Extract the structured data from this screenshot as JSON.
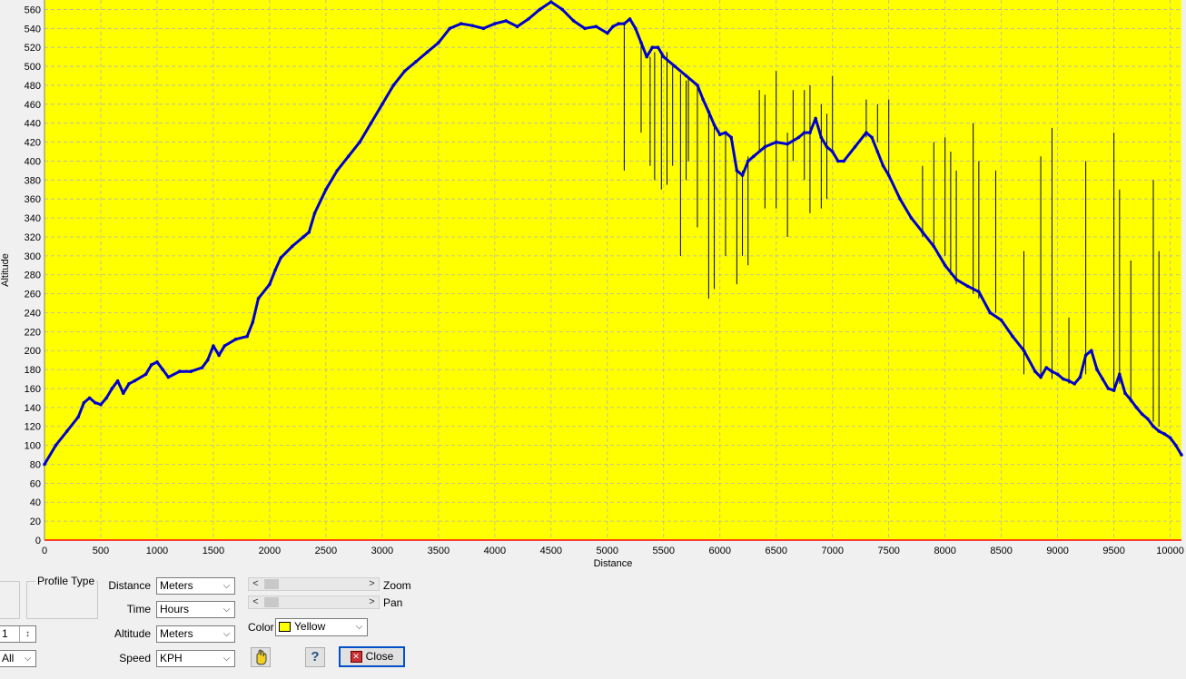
{
  "chart_data": {
    "type": "line",
    "xlabel": "Distance",
    "ylabel": "Altitude",
    "xlim": [
      0,
      10100
    ],
    "ylim": [
      0,
      570
    ],
    "x_ticks": [
      0,
      500,
      1000,
      1500,
      2000,
      2500,
      3000,
      3500,
      4000,
      4500,
      5000,
      5500,
      6000,
      6500,
      7000,
      7500,
      8000,
      8500,
      9000,
      9500,
      10000
    ],
    "y_ticks": [
      0,
      20,
      40,
      60,
      80,
      100,
      120,
      140,
      160,
      180,
      200,
      220,
      240,
      260,
      280,
      300,
      320,
      340,
      360,
      380,
      400,
      420,
      440,
      460,
      480,
      500,
      520,
      540,
      560
    ],
    "grid": true,
    "background_color": "#ffff00",
    "line_color": "#0000cc",
    "series": [
      {
        "values": [
          [
            0,
            80
          ],
          [
            100,
            100
          ],
          [
            200,
            115
          ],
          [
            300,
            130
          ],
          [
            350,
            145
          ],
          [
            400,
            150
          ],
          [
            450,
            145
          ],
          [
            500,
            143
          ],
          [
            550,
            150
          ],
          [
            600,
            160
          ],
          [
            650,
            168
          ],
          [
            700,
            155
          ],
          [
            750,
            165
          ],
          [
            800,
            168
          ],
          [
            900,
            175
          ],
          [
            950,
            185
          ],
          [
            1000,
            188
          ],
          [
            1050,
            180
          ],
          [
            1100,
            172
          ],
          [
            1200,
            178
          ],
          [
            1300,
            178
          ],
          [
            1400,
            182
          ],
          [
            1450,
            190
          ],
          [
            1500,
            205
          ],
          [
            1550,
            195
          ],
          [
            1600,
            205
          ],
          [
            1700,
            212
          ],
          [
            1800,
            215
          ],
          [
            1850,
            230
          ],
          [
            1900,
            255
          ],
          [
            2000,
            270
          ],
          [
            2050,
            285
          ],
          [
            2100,
            298
          ],
          [
            2200,
            310
          ],
          [
            2300,
            320
          ],
          [
            2350,
            325
          ],
          [
            2400,
            345
          ],
          [
            2500,
            370
          ],
          [
            2600,
            390
          ],
          [
            2700,
            405
          ],
          [
            2800,
            420
          ],
          [
            2900,
            440
          ],
          [
            3000,
            460
          ],
          [
            3100,
            480
          ],
          [
            3200,
            495
          ],
          [
            3300,
            505
          ],
          [
            3400,
            515
          ],
          [
            3500,
            525
          ],
          [
            3600,
            540
          ],
          [
            3700,
            545
          ],
          [
            3800,
            543
          ],
          [
            3900,
            540
          ],
          [
            4000,
            545
          ],
          [
            4100,
            548
          ],
          [
            4200,
            542
          ],
          [
            4300,
            550
          ],
          [
            4400,
            560
          ],
          [
            4500,
            568
          ],
          [
            4600,
            560
          ],
          [
            4700,
            548
          ],
          [
            4800,
            540
          ],
          [
            4900,
            542
          ],
          [
            5000,
            535
          ],
          [
            5050,
            542
          ],
          [
            5100,
            545
          ],
          [
            5150,
            545
          ],
          [
            5200,
            550
          ],
          [
            5250,
            540
          ],
          [
            5300,
            525
          ],
          [
            5350,
            510
          ],
          [
            5400,
            520
          ],
          [
            5450,
            520
          ],
          [
            5500,
            510
          ],
          [
            5600,
            500
          ],
          [
            5700,
            490
          ],
          [
            5800,
            480
          ],
          [
            5850,
            465
          ],
          [
            5900,
            452
          ],
          [
            5950,
            438
          ],
          [
            6000,
            428
          ],
          [
            6050,
            430
          ],
          [
            6100,
            425
          ],
          [
            6150,
            390
          ],
          [
            6200,
            385
          ],
          [
            6250,
            400
          ],
          [
            6300,
            405
          ],
          [
            6400,
            415
          ],
          [
            6500,
            420
          ],
          [
            6600,
            418
          ],
          [
            6700,
            425
          ],
          [
            6750,
            430
          ],
          [
            6800,
            430
          ],
          [
            6850,
            445
          ],
          [
            6900,
            425
          ],
          [
            6950,
            415
          ],
          [
            7000,
            410
          ],
          [
            7050,
            400
          ],
          [
            7100,
            400
          ],
          [
            7200,
            415
          ],
          [
            7300,
            430
          ],
          [
            7350,
            425
          ],
          [
            7400,
            410
          ],
          [
            7450,
            395
          ],
          [
            7500,
            385
          ],
          [
            7600,
            360
          ],
          [
            7700,
            340
          ],
          [
            7800,
            325
          ],
          [
            7900,
            310
          ],
          [
            8000,
            290
          ],
          [
            8100,
            275
          ],
          [
            8200,
            268
          ],
          [
            8300,
            262
          ],
          [
            8400,
            240
          ],
          [
            8500,
            232
          ],
          [
            8600,
            215
          ],
          [
            8700,
            200
          ],
          [
            8800,
            178
          ],
          [
            8850,
            172
          ],
          [
            8900,
            182
          ],
          [
            8950,
            178
          ],
          [
            9000,
            175
          ],
          [
            9050,
            170
          ],
          [
            9100,
            168
          ],
          [
            9150,
            165
          ],
          [
            9200,
            172
          ],
          [
            9250,
            195
          ],
          [
            9300,
            200
          ],
          [
            9350,
            180
          ],
          [
            9400,
            170
          ],
          [
            9450,
            160
          ],
          [
            9500,
            158
          ],
          [
            9550,
            175
          ],
          [
            9600,
            155
          ],
          [
            9650,
            148
          ],
          [
            9700,
            140
          ],
          [
            9750,
            133
          ],
          [
            9800,
            128
          ],
          [
            9850,
            120
          ],
          [
            9900,
            115
          ],
          [
            9950,
            112
          ],
          [
            10000,
            108
          ],
          [
            10050,
            100
          ],
          [
            10100,
            90
          ]
        ]
      }
    ],
    "spikes": [
      [
        5150,
        545,
        390
      ],
      [
        5300,
        525,
        430
      ],
      [
        5380,
        510,
        395
      ],
      [
        5420,
        515,
        380
      ],
      [
        5480,
        512,
        370
      ],
      [
        5530,
        515,
        375
      ],
      [
        5580,
        500,
        395
      ],
      [
        5650,
        492,
        300
      ],
      [
        5700,
        485,
        380
      ],
      [
        5720,
        490,
        400
      ],
      [
        5800,
        478,
        330
      ],
      [
        5900,
        452,
        255
      ],
      [
        5950,
        440,
        265
      ],
      [
        6050,
        430,
        300
      ],
      [
        6150,
        395,
        270
      ],
      [
        6200,
        390,
        300
      ],
      [
        6250,
        405,
        290
      ],
      [
        6350,
        475,
        410
      ],
      [
        6400,
        470,
        350
      ],
      [
        6500,
        495,
        350
      ],
      [
        6600,
        430,
        320
      ],
      [
        6650,
        475,
        400
      ],
      [
        6750,
        475,
        380
      ],
      [
        6800,
        480,
        345
      ],
      [
        6900,
        460,
        350
      ],
      [
        6950,
        450,
        360
      ],
      [
        7000,
        490,
        410
      ],
      [
        7300,
        465,
        425
      ],
      [
        7400,
        460,
        420
      ],
      [
        7500,
        465,
        385
      ],
      [
        7800,
        395,
        320
      ],
      [
        7900,
        420,
        310
      ],
      [
        8000,
        425,
        300
      ],
      [
        8050,
        410,
        280
      ],
      [
        8100,
        390,
        270
      ],
      [
        8250,
        440,
        260
      ],
      [
        8300,
        400,
        255
      ],
      [
        8450,
        390,
        240
      ],
      [
        8700,
        305,
        175
      ],
      [
        8850,
        405,
        170
      ],
      [
        8950,
        435,
        170
      ],
      [
        9100,
        235,
        165
      ],
      [
        9250,
        400,
        175
      ],
      [
        9500,
        430,
        158
      ],
      [
        9550,
        370,
        165
      ],
      [
        9650,
        295,
        145
      ],
      [
        9850,
        380,
        125
      ],
      [
        9900,
        305,
        120
      ]
    ]
  },
  "controls": {
    "profile_type_label": "Profile Type",
    "distance_label": "Distance",
    "distance_value": "Meters",
    "time_label": "Time",
    "time_value": "Hours",
    "altitude_label": "Altitude",
    "altitude_value": "Meters",
    "speed_label": "Speed",
    "speed_value": "KPH",
    "zoom_label": "Zoom",
    "pan_label": "Pan",
    "color_label": "Color",
    "color_value": "Yellow",
    "color_hex": "#ffff00",
    "close_label": "Close",
    "help_label": "?",
    "left_combo_value": "All",
    "left_spin_value": "1"
  }
}
